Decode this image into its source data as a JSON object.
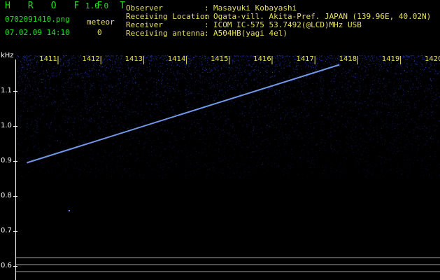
{
  "app": {
    "name": "H R O F F T",
    "version": "1.0.0"
  },
  "capture": {
    "filename": "0702091410.png",
    "timestamp": "07.02.09 14:10",
    "meteor_label": "meteor",
    "meteor_count": "0"
  },
  "info": [
    {
      "label": "Observer",
      "value": "Masayuki Kobayashi"
    },
    {
      "label": "Receiving Location",
      "value": "Ogata-vill. Akita-Pref. JAPAN (139.96E, 40.02N)"
    },
    {
      "label": "Receiver",
      "value": "ICOM IC-575 53.7492(@LCD)MHz USB"
    },
    {
      "label": "Receiving antenna",
      "value": "A504HB(yagi 4el)"
    }
  ],
  "chart_data": {
    "type": "heatmap",
    "y_unit": "kHz",
    "y_ticks": [
      "1.1",
      "1.0",
      "0.9",
      "0.8",
      "0.7",
      "0.6"
    ],
    "x_ticks": [
      "1411",
      "1412",
      "1413",
      "1414",
      "1415",
      "1416",
      "1417",
      "1418",
      "1419",
      "1420"
    ],
    "ylim": [
      0.58,
      1.2
    ],
    "xlim": [
      1410.5,
      1420.1
    ],
    "trace": {
      "x_start": 1410.5,
      "y_start": 0.895,
      "x_end": 1417.8,
      "y_end": 1.175,
      "color": "#7fa8ff"
    },
    "reference_lines_khz": [
      0.625,
      0.605,
      0.585
    ],
    "colors": {
      "noise": "#2b3cff",
      "reference_line": "#c8c8c8"
    }
  }
}
